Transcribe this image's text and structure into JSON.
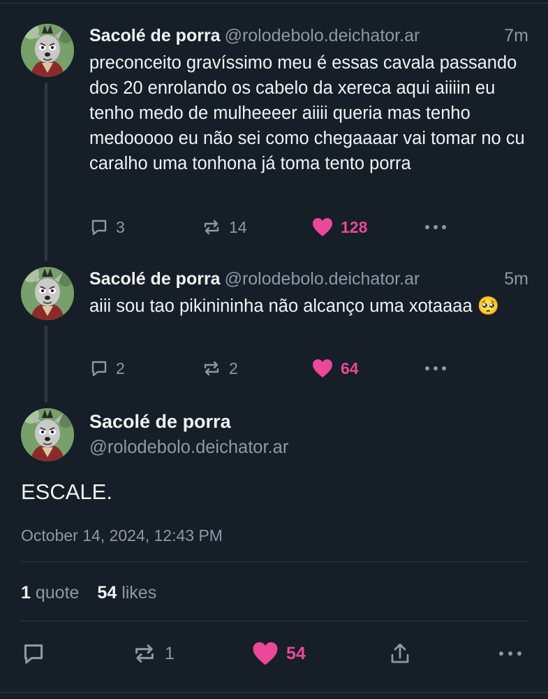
{
  "posts": [
    {
      "author": "Sacolé de porra",
      "handle": "@rolodebolo.deichator.ar",
      "time": "7m",
      "text": "preconceito gravíssimo meu é essas cavala passando dos 20 enrolando os cabelo da xereca aqui aiiiin eu tenho medo de mulheeeer aiiii queria mas tenho medooooo eu não sei como chegaaaar vai tomar no cu caralho uma tonhona já toma tento porra",
      "replies": "3",
      "reposts": "14",
      "likes": "128"
    },
    {
      "author": "Sacolé de porra",
      "handle": "@rolodebolo.deichator.ar",
      "time": "5m",
      "text": "aiii sou tao pikinininha não alcanço uma xotaaaa 🥺",
      "replies": "2",
      "reposts": "2",
      "likes": "64"
    }
  ],
  "main_post": {
    "author": "Sacolé de porra",
    "handle": "@rolodebolo.deichator.ar",
    "text": "ESCALE.",
    "date": "October 14, 2024, 12:43 PM",
    "quote_count": "1",
    "quote_label": "quote",
    "likes_count": "54",
    "likes_label": "likes",
    "reposts": "1",
    "likes": "54"
  },
  "icons": [
    "reply-icon",
    "repost-icon",
    "heart-icon",
    "more-icon",
    "share-icon"
  ],
  "colors": {
    "background": "#161e27",
    "like": "#ec4899",
    "muted": "#8e99a6",
    "text": "#f1f3f5"
  }
}
